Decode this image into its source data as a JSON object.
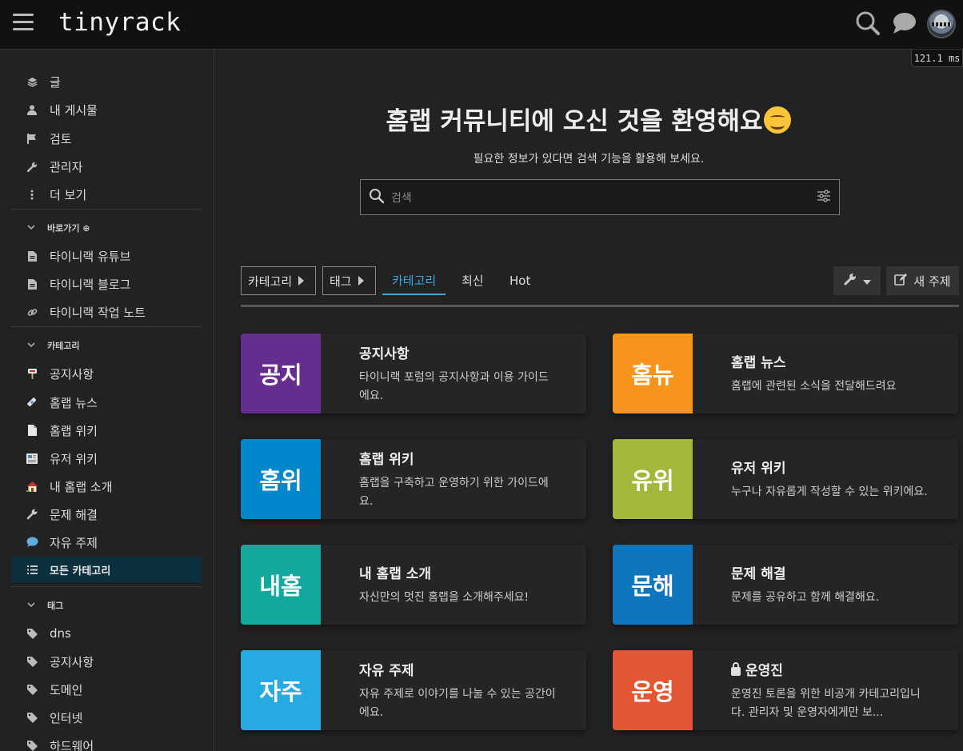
{
  "header": {
    "logo": "tinyrack",
    "timing": "121.1 ms"
  },
  "sidebar": {
    "top_items": [
      {
        "label": "글",
        "icon": "layers-icon"
      },
      {
        "label": "내 게시물",
        "icon": "user-icon"
      },
      {
        "label": "검토",
        "icon": "flag-icon"
      },
      {
        "label": "관리자",
        "icon": "wrench-icon"
      },
      {
        "label": "더 보기",
        "icon": "more-vertical-icon"
      }
    ],
    "shortcuts_header": "바로가기 ⊕",
    "shortcuts": [
      {
        "label": "타이니랙 유튜브",
        "icon": "file-icon"
      },
      {
        "label": "타이니랙 블로그",
        "icon": "file-icon"
      },
      {
        "label": "타이니랙 작업 노트",
        "icon": "link-icon"
      }
    ],
    "categories_header": "카테고리",
    "categories": [
      {
        "label": "공지사항",
        "icon": "pushpin-icon"
      },
      {
        "label": "홈랩 뉴스",
        "icon": "satellite-icon"
      },
      {
        "label": "홈랩 위키",
        "icon": "page-icon"
      },
      {
        "label": "유저 위키",
        "icon": "newspaper-icon"
      },
      {
        "label": "내 홈랩 소개",
        "icon": "house-icon"
      },
      {
        "label": "문제 해결",
        "icon": "wrench-icon"
      },
      {
        "label": "자유 주제",
        "icon": "speech-balloon-icon"
      },
      {
        "label": "모든 카테고리",
        "icon": "list-icon"
      }
    ],
    "tags_header": "태그",
    "tags": [
      {
        "label": "dns",
        "icon": "tag-icon"
      },
      {
        "label": "공지사항",
        "icon": "tag-icon"
      },
      {
        "label": "도메인",
        "icon": "tag-icon"
      },
      {
        "label": "인터넷",
        "icon": "tag-icon"
      },
      {
        "label": "하드웨어",
        "icon": "tag-icon"
      }
    ]
  },
  "main": {
    "welcome_title": "홈랩 커뮤니티에 오신 것을 환영해요",
    "welcome_subtitle": "필요한 정보가 있다면 검색 기능을 활용해 보세요.",
    "search_placeholder": "검색",
    "toolbar": {
      "category_dropdown": "카테고리",
      "tag_dropdown": "태그",
      "tabs": [
        "카테고리",
        "최신",
        "Hot"
      ],
      "active_tab": "카테고리",
      "new_topic": "새 주제"
    },
    "categories": [
      {
        "badge": "공지",
        "title": "공지사항",
        "desc": "타이니랙 포럼의 공지사항과 이용 가이드에요.",
        "color": "#652d90"
      },
      {
        "badge": "홈뉴",
        "title": "홈랩 뉴스",
        "desc": "홈랩에 관련된 소식을 전달해드려요",
        "color": "#f7941d"
      },
      {
        "badge": "홈위",
        "title": "홈랩 위키",
        "desc": "홈랩을 구축하고 운영하기 위한 가이드에요.",
        "color": "#0088cc"
      },
      {
        "badge": "유위",
        "title": "유저 위키",
        "desc": "누구나 자유롭게 작성할 수 있는 위키에요.",
        "color": "#a3b83b"
      },
      {
        "badge": "내홈",
        "title": "내 홈랩 소개",
        "desc": "자신만의 멋진 홈랩을 소개해주세요!",
        "color": "#12a89d"
      },
      {
        "badge": "문해",
        "title": "문제 해결",
        "desc": "문제를 공유하고 함께 해결해요.",
        "color": "#0e76bd"
      },
      {
        "badge": "자주",
        "title": "자유 주제",
        "desc": "자유 주제로 이야기를 나눌 수 있는 공간이에요.",
        "color": "#25aae1"
      },
      {
        "badge": "운영",
        "title": "운영진",
        "desc": "운영진 토론을 위한 비공개 카테고리입니다. 관리자 및 운영자에게만 보...",
        "color": "#e45735",
        "locked": true
      }
    ]
  }
}
